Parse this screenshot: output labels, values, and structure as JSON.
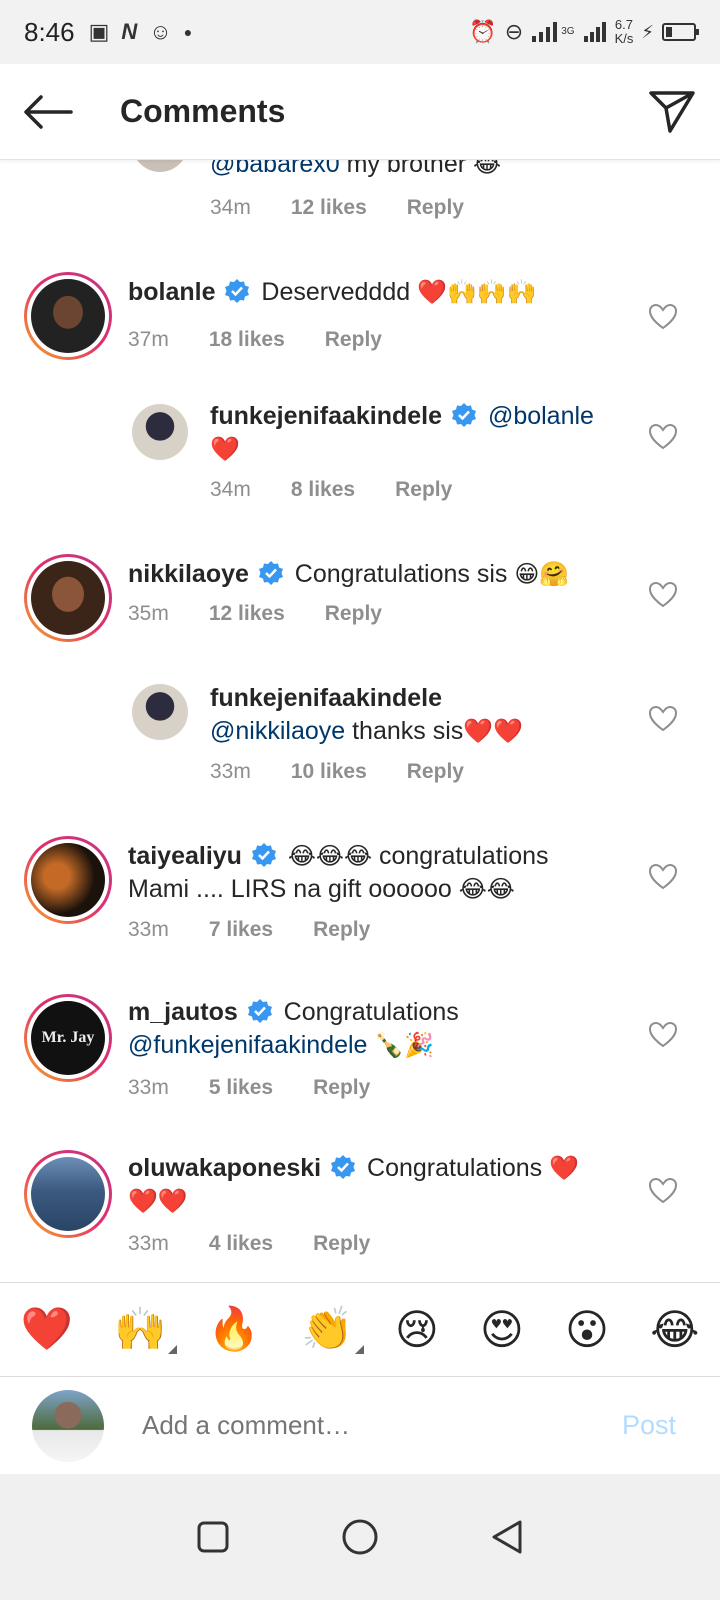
{
  "status_bar": {
    "time": "8:46",
    "speed_value": "6.7",
    "speed_unit": "K/s",
    "network": "3G"
  },
  "header": {
    "title": "Comments"
  },
  "comments": [
    {
      "username": "",
      "text_mention": "@babarex0",
      "text": " my brother ",
      "emoji": "😂",
      "time": "34m",
      "likes": "12 likes",
      "reply": "Reply",
      "reply_level": true
    },
    {
      "username": "bolanle",
      "verified": true,
      "text": " Deservedddd ",
      "emoji": "❤️🙌🙌🙌",
      "time": "37m",
      "likes": "18 likes",
      "reply": "Reply"
    },
    {
      "username": "funkejenifaakindele",
      "verified": true,
      "text_mention": "@bolanle",
      "emoji": "❤️",
      "time": "34m",
      "likes": "8 likes",
      "reply": "Reply",
      "reply_level": true
    },
    {
      "username": "nikkilaoye",
      "verified": true,
      "text": " Congratulations sis ",
      "emoji": "😁🤗",
      "time": "35m",
      "likes": "12 likes",
      "reply": "Reply"
    },
    {
      "username": "funkejenifaakindele",
      "text_mention": "@nikkilaoye",
      "text": " thanks sis",
      "emoji": "❤️❤️",
      "time": "33m",
      "likes": "10 likes",
      "reply": "Reply",
      "reply_level": true
    },
    {
      "username": "taiyealiyu",
      "verified": true,
      "emoji_lead": "😂😂😂",
      "text": " congratulations Mami .... LIRS na gift oooooo ",
      "emoji": "😂😂",
      "time": "33m",
      "likes": "7 likes",
      "reply": "Reply"
    },
    {
      "username": "m_jautos",
      "verified": true,
      "text": " Congratulations ",
      "text_mention": "@funkejenifaakindele",
      "emoji": " 🍾🎉",
      "time": "33m",
      "likes": "5 likes",
      "reply": "Reply",
      "avatar_text": "Mr. Jay"
    },
    {
      "username": "oluwakaponeski",
      "verified": true,
      "text": " Congratulations ",
      "emoji": "❤️❤️❤️",
      "time": "33m",
      "likes": "4 likes",
      "reply": "Reply"
    }
  ],
  "emoji_bar": [
    "❤️",
    "🙌",
    "🔥",
    "👏",
    "😢",
    "😍",
    "😮",
    "😂"
  ],
  "input": {
    "placeholder": "Add a comment…",
    "post_label": "Post"
  },
  "colors": {
    "mention": "#00376b",
    "verified": "#3897f0",
    "post_disabled": "#b3dbff",
    "meta": "#8e8e8e"
  }
}
